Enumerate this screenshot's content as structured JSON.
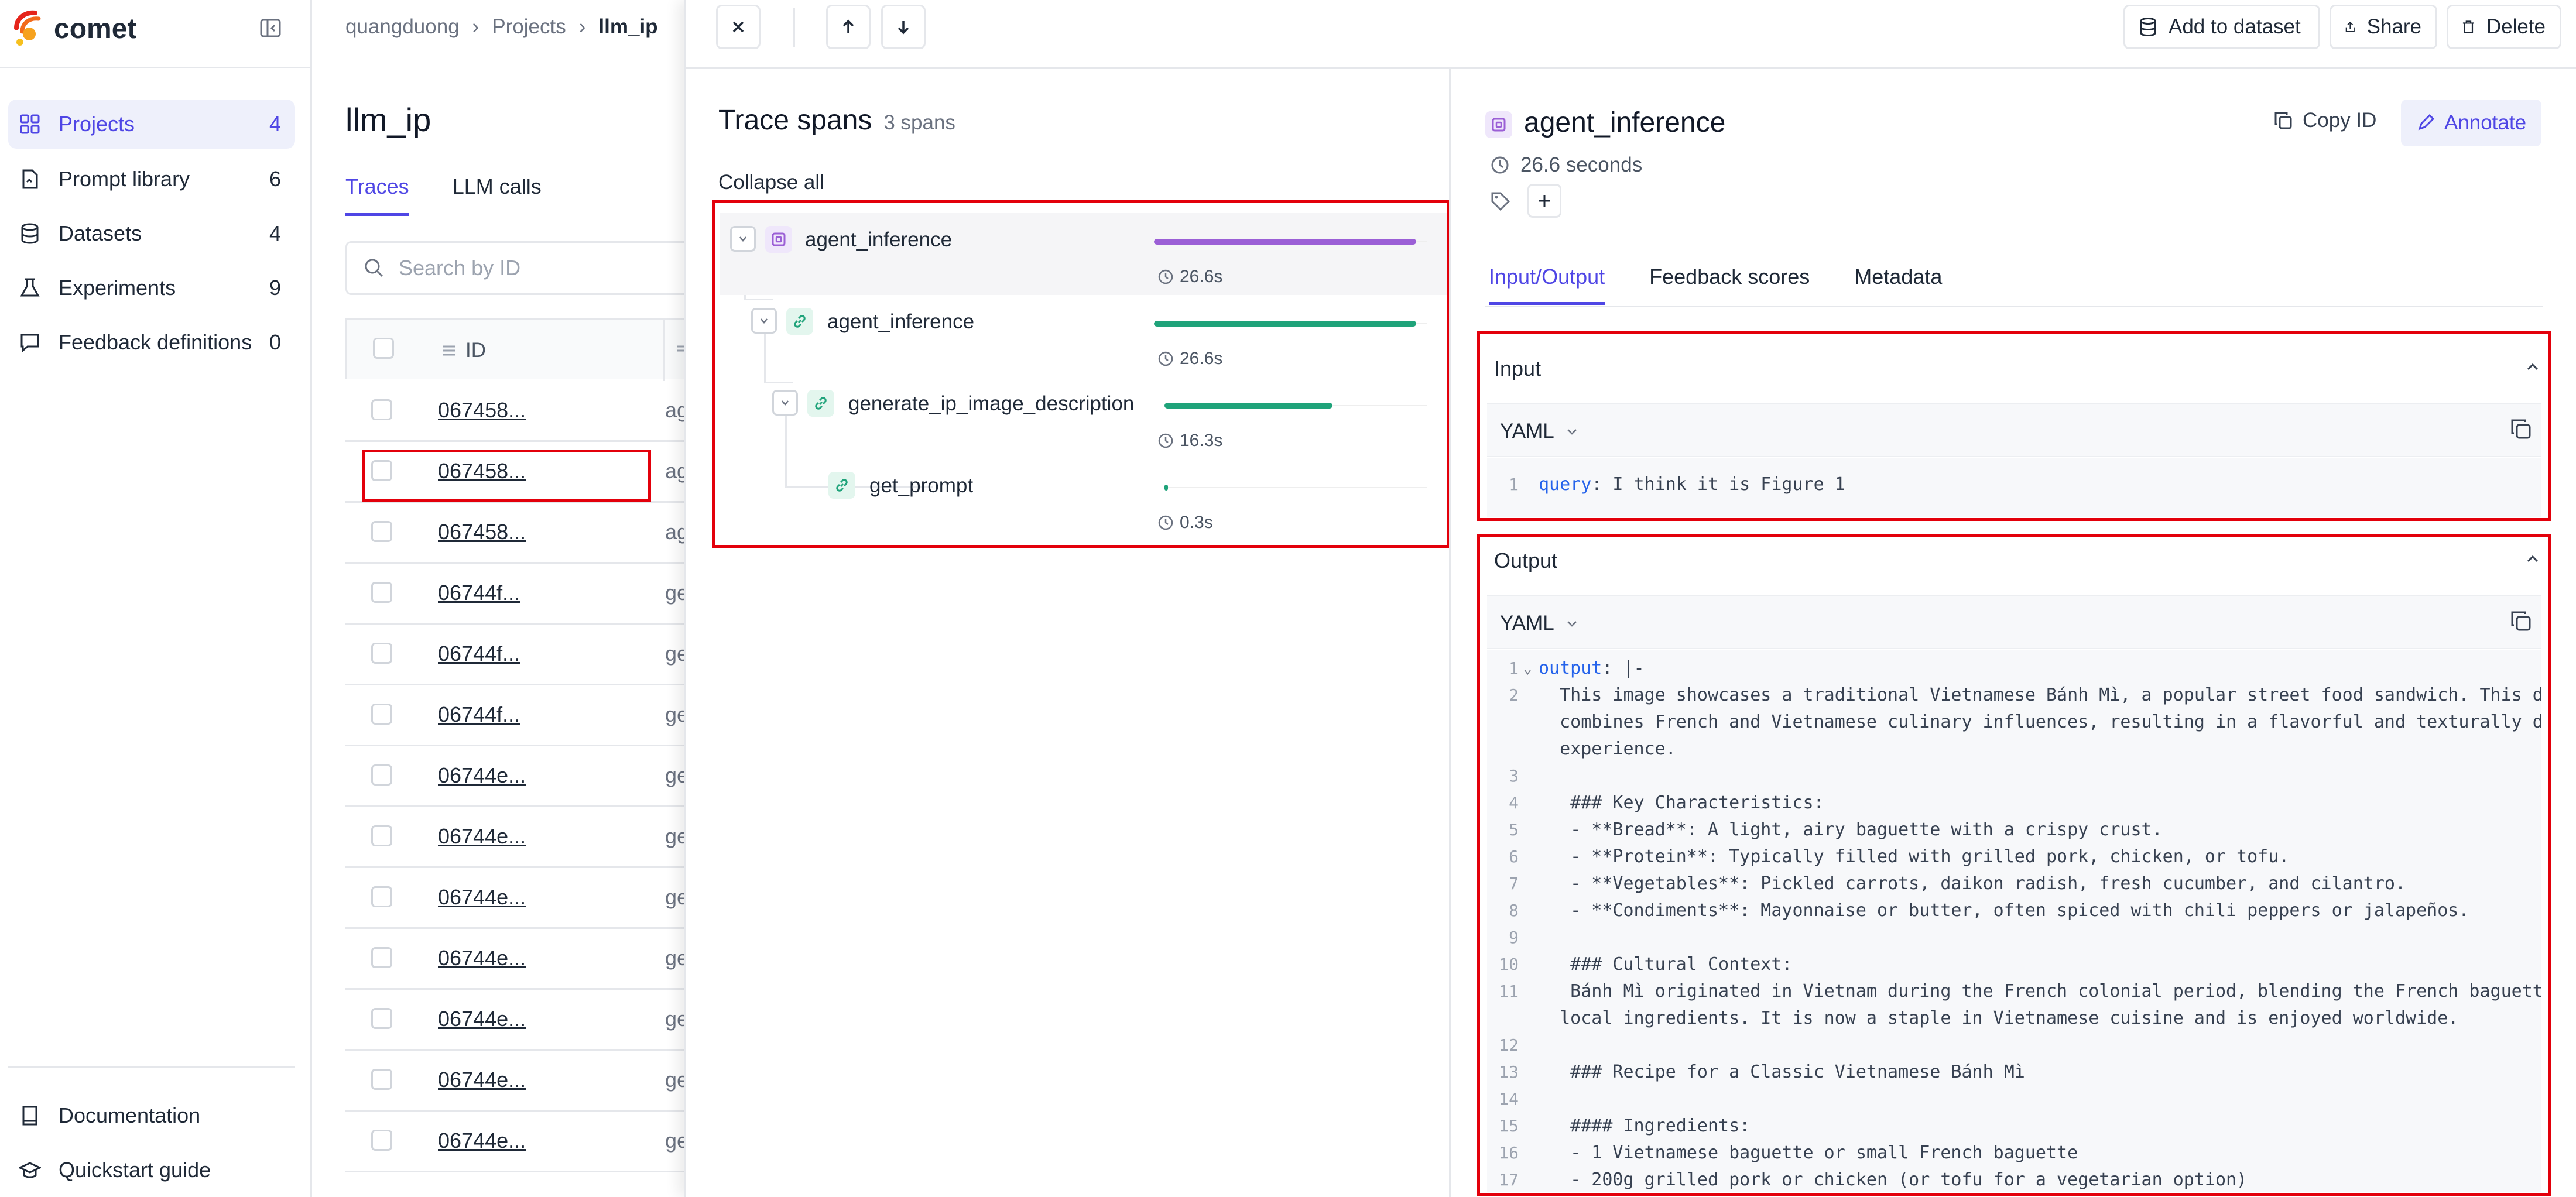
{
  "sidebar": {
    "logo_text": "comet",
    "nav": [
      {
        "label": "Projects",
        "count": "4",
        "icon": "grid-icon",
        "active": true
      },
      {
        "label": "Prompt library",
        "count": "6",
        "icon": "document-icon"
      },
      {
        "label": "Datasets",
        "count": "4",
        "icon": "database-icon"
      },
      {
        "label": "Experiments",
        "count": "9",
        "icon": "flask-icon"
      },
      {
        "label": "Feedback definitions",
        "count": "0",
        "icon": "message-icon"
      }
    ],
    "bottom": [
      {
        "label": "Documentation",
        "icon": "book-icon"
      },
      {
        "label": "Quickstart guide",
        "icon": "graduation-cap-icon"
      }
    ]
  },
  "project": {
    "breadcrumb": [
      "quangduong",
      "Projects",
      "llm_ip"
    ],
    "title": "llm_ip",
    "tabs": [
      "Traces",
      "LLM calls"
    ],
    "search_placeholder": "Search by ID",
    "id_header": "ID",
    "rows": [
      {
        "id": "067458...",
        "name": "ag"
      },
      {
        "id": "067458...",
        "name": "ag"
      },
      {
        "id": "067458...",
        "name": "ag"
      },
      {
        "id": "06744f...",
        "name": "ge"
      },
      {
        "id": "06744f...",
        "name": "ge"
      },
      {
        "id": "06744f...",
        "name": "ge"
      },
      {
        "id": "06744e...",
        "name": "ge"
      },
      {
        "id": "06744e...",
        "name": "ge"
      },
      {
        "id": "06744e...",
        "name": "ge"
      },
      {
        "id": "06744e...",
        "name": "ge"
      },
      {
        "id": "06744e...",
        "name": "ge"
      },
      {
        "id": "06744e...",
        "name": "ge"
      },
      {
        "id": "06744e...",
        "name": "ge"
      }
    ]
  },
  "toolbar": {
    "add_to_dataset": "Add to dataset",
    "share": "Share",
    "delete": "Delete"
  },
  "spans": {
    "title": "Trace spans",
    "count": "3 spans",
    "collapse_all": "Collapse all",
    "items": [
      {
        "name": "agent_inference",
        "duration": "26.6s",
        "fraction": 1.0,
        "color": "#9b5fd6",
        "type": "trace"
      },
      {
        "name": "agent_inference",
        "duration": "26.6s",
        "fraction": 1.0,
        "color": "#1fa37a",
        "type": "span"
      },
      {
        "name": "generate_ip_image_description",
        "duration": "16.3s",
        "fraction": 0.64,
        "color": "#1fa37a",
        "type": "span"
      },
      {
        "name": "get_prompt",
        "duration": "0.3s",
        "fraction": 0.01,
        "color": "#1fa37a",
        "type": "span"
      }
    ]
  },
  "detail": {
    "title": "agent_inference",
    "duration": "26.6 seconds",
    "copy_id": "Copy ID",
    "annotate": "Annotate",
    "tabs": [
      "Input/Output",
      "Feedback scores",
      "Metadata"
    ],
    "input": {
      "header": "Input",
      "format": "YAML",
      "lines": [
        {
          "n": "1",
          "key": "query",
          "text": " I think it is Figure 1"
        }
      ]
    },
    "output": {
      "header": "Output",
      "format": "YAML",
      "lines": [
        {
          "n": "1",
          "key": "output",
          "text": " |-",
          "fold": true
        },
        {
          "n": "2",
          "text": "  This image showcases a traditional Vietnamese Bánh Mì, a popular street food sandwich. This dish"
        },
        {
          "n": "",
          "text": "  combines French and Vietnamese culinary influences, resulting in a flavorful and texturally diverse"
        },
        {
          "n": "",
          "text": "  experience."
        },
        {
          "n": "3",
          "text": ""
        },
        {
          "n": "4",
          "text": "   ### Key Characteristics:"
        },
        {
          "n": "5",
          "text": "   - **Bread**: A light, airy baguette with a crispy crust."
        },
        {
          "n": "6",
          "text": "   - **Protein**: Typically filled with grilled pork, chicken, or tofu."
        },
        {
          "n": "7",
          "text": "   - **Vegetables**: Pickled carrots, daikon radish, fresh cucumber, and cilantro."
        },
        {
          "n": "8",
          "text": "   - **Condiments**: Mayonnaise or butter, often spiced with chili peppers or jalapeños."
        },
        {
          "n": "9",
          "text": ""
        },
        {
          "n": "10",
          "text": "   ### Cultural Context:"
        },
        {
          "n": "11",
          "text": "   Bánh Mì originated in Vietnam during the French colonial period, blending the French baguette with"
        },
        {
          "n": "",
          "text": "  local ingredients. It is now a staple in Vietnamese cuisine and is enjoyed worldwide."
        },
        {
          "n": "12",
          "text": ""
        },
        {
          "n": "13",
          "text": "   ### Recipe for a Classic Vietnamese Bánh Mì"
        },
        {
          "n": "14",
          "text": ""
        },
        {
          "n": "15",
          "text": "   #### Ingredients:"
        },
        {
          "n": "16",
          "text": "   - 1 Vietnamese baguette or small French baguette"
        },
        {
          "n": "17",
          "text": "   - 200g grilled pork or chicken (or tofu for a vegetarian option)"
        }
      ]
    }
  }
}
